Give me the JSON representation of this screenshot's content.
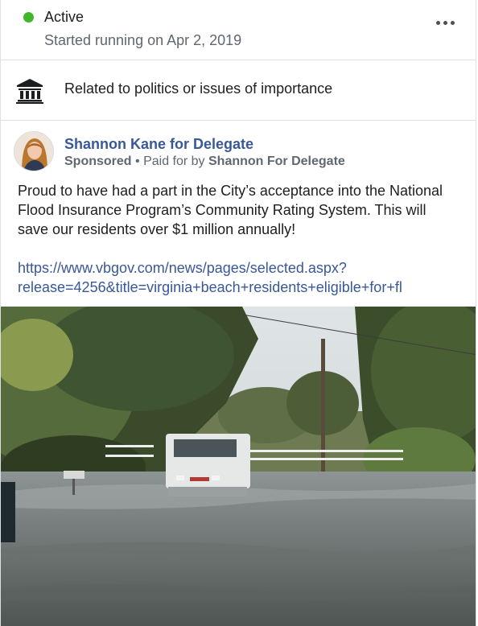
{
  "status": {
    "label": "Active",
    "started": "Started running on Apr 2, 2019",
    "dot_color": "#42b72a",
    "more_icon": "more-horizontal-icon"
  },
  "category": {
    "icon": "institution-icon",
    "label": "Related to politics or issues of importance"
  },
  "ad": {
    "advertiser": "Shannon Kane for Delegate",
    "sponsored": "Sponsored",
    "separator": " • ",
    "paid_prefix": "Paid for by ",
    "payer": "Shannon For Delegate",
    "body": "Proud to have had a part in the City’s acceptance into the National Flood Insurance Program’s Community Rating System. This will save our residents over $1 million annually!",
    "link_line1": "https://www.vbgov.com/news/pages/selected.aspx?",
    "link_line2": "release=4256&title=virginia+beach+residents+eligible+for+fl",
    "link_color": "#385898"
  }
}
